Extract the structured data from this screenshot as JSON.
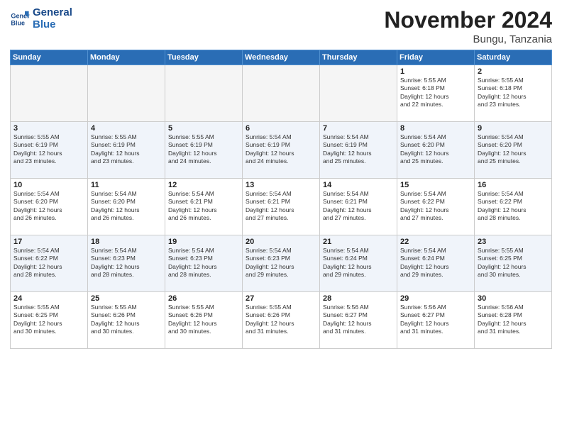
{
  "header": {
    "logo_line1": "General",
    "logo_line2": "Blue",
    "month": "November 2024",
    "location": "Bungu, Tanzania"
  },
  "weekdays": [
    "Sunday",
    "Monday",
    "Tuesday",
    "Wednesday",
    "Thursday",
    "Friday",
    "Saturday"
  ],
  "weeks": [
    [
      {
        "day": "",
        "info": ""
      },
      {
        "day": "",
        "info": ""
      },
      {
        "day": "",
        "info": ""
      },
      {
        "day": "",
        "info": ""
      },
      {
        "day": "",
        "info": ""
      },
      {
        "day": "1",
        "info": "Sunrise: 5:55 AM\nSunset: 6:18 PM\nDaylight: 12 hours\nand 22 minutes."
      },
      {
        "day": "2",
        "info": "Sunrise: 5:55 AM\nSunset: 6:18 PM\nDaylight: 12 hours\nand 23 minutes."
      }
    ],
    [
      {
        "day": "3",
        "info": "Sunrise: 5:55 AM\nSunset: 6:19 PM\nDaylight: 12 hours\nand 23 minutes."
      },
      {
        "day": "4",
        "info": "Sunrise: 5:55 AM\nSunset: 6:19 PM\nDaylight: 12 hours\nand 23 minutes."
      },
      {
        "day": "5",
        "info": "Sunrise: 5:55 AM\nSunset: 6:19 PM\nDaylight: 12 hours\nand 24 minutes."
      },
      {
        "day": "6",
        "info": "Sunrise: 5:54 AM\nSunset: 6:19 PM\nDaylight: 12 hours\nand 24 minutes."
      },
      {
        "day": "7",
        "info": "Sunrise: 5:54 AM\nSunset: 6:19 PM\nDaylight: 12 hours\nand 25 minutes."
      },
      {
        "day": "8",
        "info": "Sunrise: 5:54 AM\nSunset: 6:20 PM\nDaylight: 12 hours\nand 25 minutes."
      },
      {
        "day": "9",
        "info": "Sunrise: 5:54 AM\nSunset: 6:20 PM\nDaylight: 12 hours\nand 25 minutes."
      }
    ],
    [
      {
        "day": "10",
        "info": "Sunrise: 5:54 AM\nSunset: 6:20 PM\nDaylight: 12 hours\nand 26 minutes."
      },
      {
        "day": "11",
        "info": "Sunrise: 5:54 AM\nSunset: 6:20 PM\nDaylight: 12 hours\nand 26 minutes."
      },
      {
        "day": "12",
        "info": "Sunrise: 5:54 AM\nSunset: 6:21 PM\nDaylight: 12 hours\nand 26 minutes."
      },
      {
        "day": "13",
        "info": "Sunrise: 5:54 AM\nSunset: 6:21 PM\nDaylight: 12 hours\nand 27 minutes."
      },
      {
        "day": "14",
        "info": "Sunrise: 5:54 AM\nSunset: 6:21 PM\nDaylight: 12 hours\nand 27 minutes."
      },
      {
        "day": "15",
        "info": "Sunrise: 5:54 AM\nSunset: 6:22 PM\nDaylight: 12 hours\nand 27 minutes."
      },
      {
        "day": "16",
        "info": "Sunrise: 5:54 AM\nSunset: 6:22 PM\nDaylight: 12 hours\nand 28 minutes."
      }
    ],
    [
      {
        "day": "17",
        "info": "Sunrise: 5:54 AM\nSunset: 6:22 PM\nDaylight: 12 hours\nand 28 minutes."
      },
      {
        "day": "18",
        "info": "Sunrise: 5:54 AM\nSunset: 6:23 PM\nDaylight: 12 hours\nand 28 minutes."
      },
      {
        "day": "19",
        "info": "Sunrise: 5:54 AM\nSunset: 6:23 PM\nDaylight: 12 hours\nand 28 minutes."
      },
      {
        "day": "20",
        "info": "Sunrise: 5:54 AM\nSunset: 6:23 PM\nDaylight: 12 hours\nand 29 minutes."
      },
      {
        "day": "21",
        "info": "Sunrise: 5:54 AM\nSunset: 6:24 PM\nDaylight: 12 hours\nand 29 minutes."
      },
      {
        "day": "22",
        "info": "Sunrise: 5:54 AM\nSunset: 6:24 PM\nDaylight: 12 hours\nand 29 minutes."
      },
      {
        "day": "23",
        "info": "Sunrise: 5:55 AM\nSunset: 6:25 PM\nDaylight: 12 hours\nand 30 minutes."
      }
    ],
    [
      {
        "day": "24",
        "info": "Sunrise: 5:55 AM\nSunset: 6:25 PM\nDaylight: 12 hours\nand 30 minutes."
      },
      {
        "day": "25",
        "info": "Sunrise: 5:55 AM\nSunset: 6:26 PM\nDaylight: 12 hours\nand 30 minutes."
      },
      {
        "day": "26",
        "info": "Sunrise: 5:55 AM\nSunset: 6:26 PM\nDaylight: 12 hours\nand 30 minutes."
      },
      {
        "day": "27",
        "info": "Sunrise: 5:55 AM\nSunset: 6:26 PM\nDaylight: 12 hours\nand 31 minutes."
      },
      {
        "day": "28",
        "info": "Sunrise: 5:56 AM\nSunset: 6:27 PM\nDaylight: 12 hours\nand 31 minutes."
      },
      {
        "day": "29",
        "info": "Sunrise: 5:56 AM\nSunset: 6:27 PM\nDaylight: 12 hours\nand 31 minutes."
      },
      {
        "day": "30",
        "info": "Sunrise: 5:56 AM\nSunset: 6:28 PM\nDaylight: 12 hours\nand 31 minutes."
      }
    ]
  ]
}
